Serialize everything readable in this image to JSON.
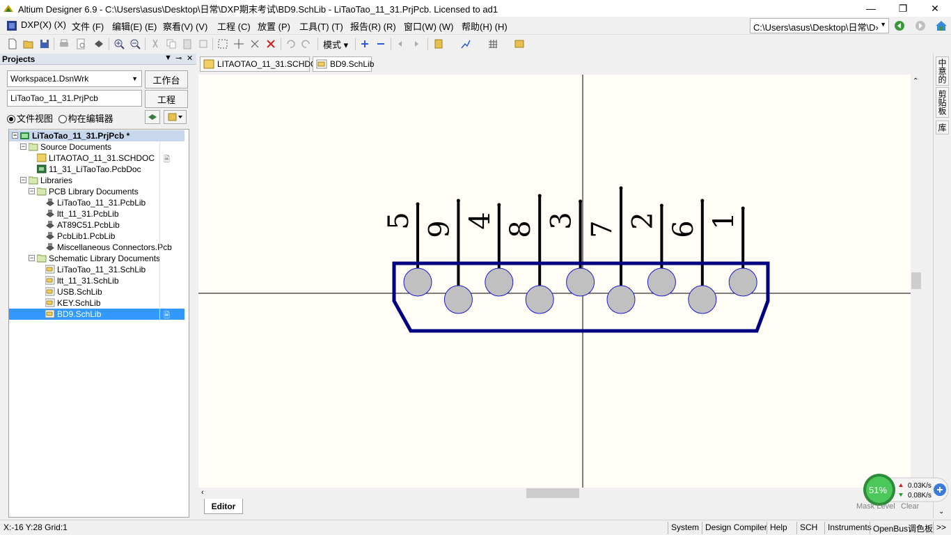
{
  "window": {
    "title": "Altium Designer 6.9 - C:\\Users\\asus\\Desktop\\日常\\DXP期末考试\\BD9.SchLib - LiTaoTao_11_31.PrjPcb. Licensed to ad1",
    "minimize_glyph": "—",
    "maximize_glyph": "❐",
    "close_glyph": "✕"
  },
  "menu": {
    "items": [
      "DXP(X) (X)",
      "文件 (F)",
      "编辑(E) (E)",
      "察看(V) (V)",
      "工程 (C)",
      "放置 (P)",
      "工具(T) (T)",
      "报告(R) (R)",
      "窗口(W) (W)",
      "帮助(H) (H)"
    ],
    "path": "C:\\Users\\asus\\Desktop\\日常\\D›"
  },
  "toolbar": {
    "mode_label": "模式 ▾"
  },
  "projects": {
    "title": "Projects",
    "workspace": "Workspace1.DsnWrk",
    "workspace_button": "工作台",
    "project": "LiTaoTao_11_31.PrjPcb",
    "project_button": "工程",
    "radio_file_view": "文件视图",
    "radio_struct_editor": "构在编辑器",
    "tree": [
      {
        "label": "LiTaoTao_11_31.PrjPcb *",
        "level": 0,
        "kind": "project",
        "toggle": "−",
        "root": true
      },
      {
        "label": "Source Documents",
        "level": 1,
        "kind": "folder",
        "toggle": "−"
      },
      {
        "label": "LITAOTAO_11_31.SCHDOC",
        "level": 2,
        "kind": "sch",
        "toggle": "",
        "doc_icon": true
      },
      {
        "label": "11_31_LiTaoTao.PcbDoc",
        "level": 2,
        "kind": "pcb",
        "toggle": ""
      },
      {
        "label": "Libraries",
        "level": 1,
        "kind": "folder",
        "toggle": "−"
      },
      {
        "label": "PCB Library Documents",
        "level": 2,
        "kind": "folder",
        "toggle": "−"
      },
      {
        "label": "LiTaoTao_11_31.PcbLib",
        "level": 3,
        "kind": "pcblib",
        "toggle": ""
      },
      {
        "label": "ltt_11_31.PcbLib",
        "level": 3,
        "kind": "pcblib",
        "toggle": ""
      },
      {
        "label": "AT89C51.PcbLib",
        "level": 3,
        "kind": "pcblib",
        "toggle": ""
      },
      {
        "label": "PcbLib1.PcbLib",
        "level": 3,
        "kind": "pcblib",
        "toggle": ""
      },
      {
        "label": "Miscellaneous Connectors.Pcb",
        "level": 3,
        "kind": "pcblib",
        "toggle": ""
      },
      {
        "label": "Schematic Library Documents",
        "level": 2,
        "kind": "folder",
        "toggle": "−"
      },
      {
        "label": "LiTaoTao_11_31.SchLib",
        "level": 3,
        "kind": "schlib",
        "toggle": ""
      },
      {
        "label": "ltt_11_31.SchLib",
        "level": 3,
        "kind": "schlib",
        "toggle": ""
      },
      {
        "label": "USB.SchLib",
        "level": 3,
        "kind": "schlib",
        "toggle": ""
      },
      {
        "label": "KEY.SchLib",
        "level": 3,
        "kind": "schlib",
        "toggle": ""
      },
      {
        "label": "BD9.SchLib",
        "level": 3,
        "kind": "schlib",
        "toggle": "",
        "selected": true,
        "doc_icon": true
      }
    ]
  },
  "doc_tabs": [
    {
      "label": "LITAOTAO_11_31.SCHDOC",
      "icon": "schematic-doc-icon",
      "active": false
    },
    {
      "label": "BD9.SchLib",
      "icon": "schlib-doc-icon",
      "active": true
    }
  ],
  "schematic": {
    "component": "DB9 connector",
    "pins": [
      {
        "number": "5",
        "tall": false
      },
      {
        "number": "9",
        "tall": true
      },
      {
        "number": "4",
        "tall": false
      },
      {
        "number": "8",
        "tall": true
      },
      {
        "number": "3",
        "tall": false
      },
      {
        "number": "7",
        "tall": true
      },
      {
        "number": "2",
        "tall": false
      },
      {
        "number": "6",
        "tall": true
      },
      {
        "number": "1",
        "tall": false
      }
    ],
    "body_color": "#000080",
    "pad_color": "#c0c0c0",
    "canvas_color": "#fffdf6"
  },
  "editor_tab": "Editor",
  "side_panel_tabs": [
    "中意的",
    "剪贴板",
    "库"
  ],
  "network": {
    "percent": "51%",
    "upload": "0.03K/s",
    "download": "0.08K/s",
    "mask_level": "Mask Level",
    "clear": "Clear"
  },
  "status": {
    "coords": "X:-16 Y:28   Grid:1",
    "buttons": [
      "System",
      "Design Compiler",
      "Help",
      "SCH",
      "Instruments",
      "OpenBus调色板",
      ">>"
    ]
  }
}
